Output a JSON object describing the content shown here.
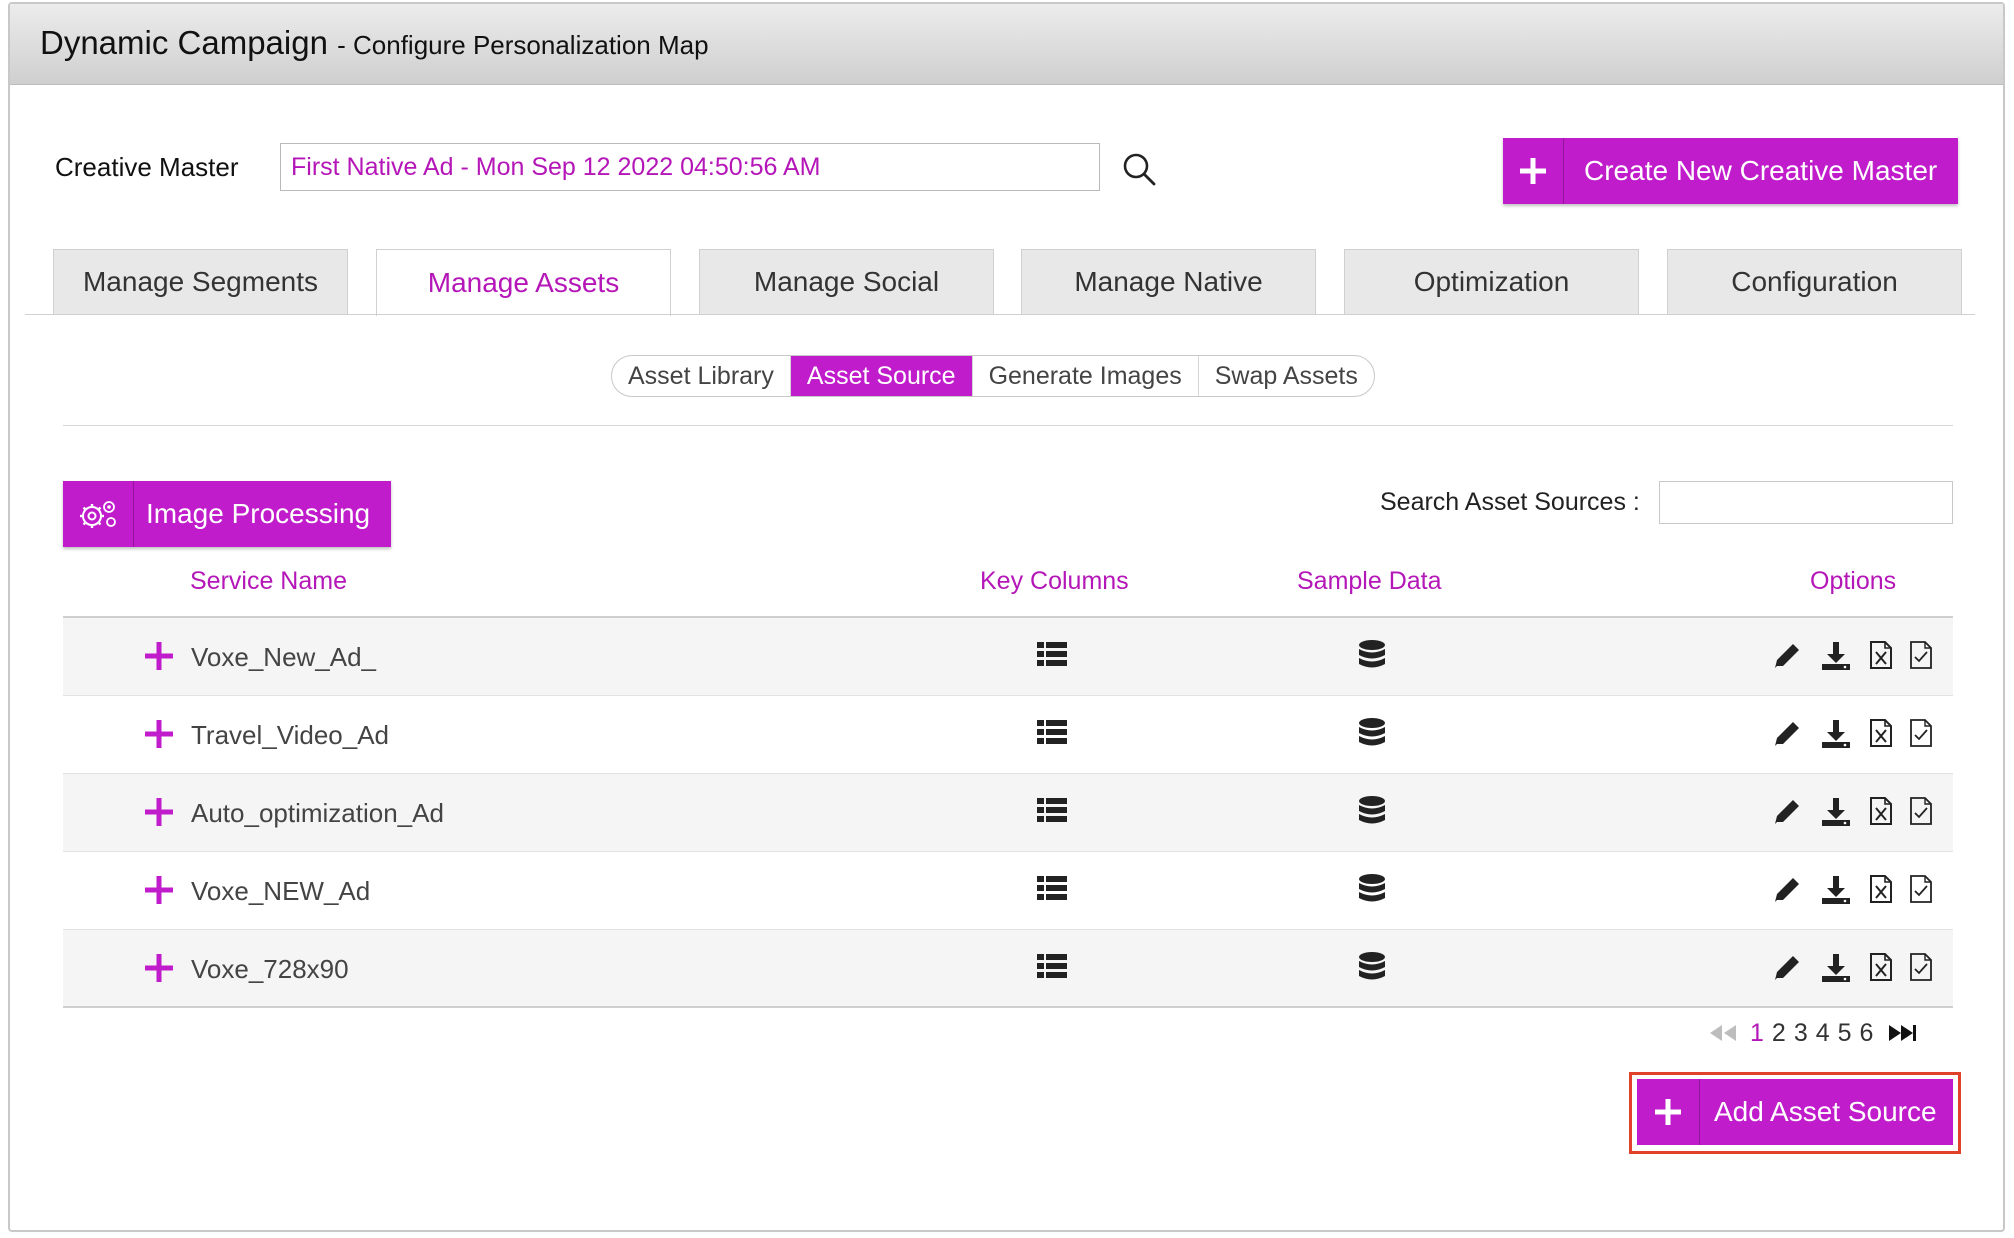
{
  "window": {
    "title": "Dynamic Campaign",
    "subtitle": "- Configure Personalization Map"
  },
  "creative_master": {
    "label": "Creative Master",
    "value": "First Native Ad - Mon Sep 12 2022 04:50:56 AM",
    "search_icon": "search-icon",
    "create_button_label": "Create New Creative Master"
  },
  "tabs": [
    {
      "label": "Manage Segments",
      "active": false
    },
    {
      "label": "Manage Assets",
      "active": true
    },
    {
      "label": "Manage Social",
      "active": false
    },
    {
      "label": "Manage Native",
      "active": false
    },
    {
      "label": "Optimization",
      "active": false
    },
    {
      "label": "Configuration",
      "active": false
    }
  ],
  "subtabs": [
    {
      "label": "Asset Library",
      "active": false
    },
    {
      "label": "Asset Source",
      "active": true
    },
    {
      "label": "Generate Images",
      "active": false
    },
    {
      "label": "Swap Assets",
      "active": false
    }
  ],
  "toolbar": {
    "image_processing_label": "Image Processing",
    "search_label": "Search Asset Sources :",
    "search_value": ""
  },
  "table": {
    "headers": {
      "service_name": "Service Name",
      "key_columns": "Key Columns",
      "sample_data": "Sample Data",
      "options": "Options"
    },
    "rows": [
      {
        "service_name": "Voxe_New_Ad_"
      },
      {
        "service_name": "Travel_Video_Ad"
      },
      {
        "service_name": "Auto_optimization_Ad"
      },
      {
        "service_name": "Voxe_NEW_Ad"
      },
      {
        "service_name": "Voxe_728x90"
      }
    ]
  },
  "pagination": {
    "current": "1",
    "pages": [
      "1",
      "2",
      "3",
      "4",
      "5",
      "6"
    ]
  },
  "add_asset_source_label": "Add Asset Source",
  "colors": {
    "accent": "#c01ccb",
    "accent_text": "#b516b8",
    "highlight_border": "#e0412b"
  }
}
